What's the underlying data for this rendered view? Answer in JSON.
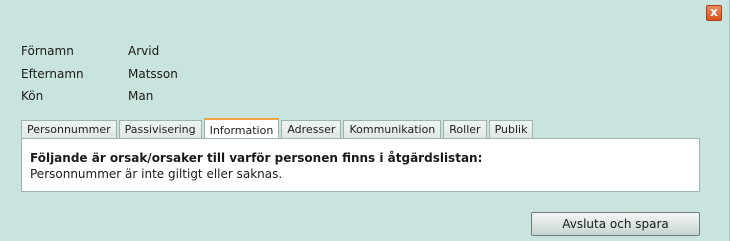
{
  "dialog": {
    "close_glyph": "x"
  },
  "person": {
    "fields": [
      {
        "label": "Förnamn",
        "value": "Arvid"
      },
      {
        "label": "Efternamn",
        "value": "Matsson"
      },
      {
        "label": "Kön",
        "value": "Man"
      }
    ]
  },
  "tabs": [
    {
      "label": "Personnummer",
      "active": false
    },
    {
      "label": "Passivisering",
      "active": false
    },
    {
      "label": "Information",
      "active": true
    },
    {
      "label": "Adresser",
      "active": false
    },
    {
      "label": "Kommunikation",
      "active": false
    },
    {
      "label": "Roller",
      "active": false
    },
    {
      "label": "Publik",
      "active": false
    }
  ],
  "panel": {
    "heading": "Följande är orsak/orsaker till varför personen finns i åtgärdslistan:",
    "text": "Personnummer är inte giltigt eller saknas."
  },
  "actions": {
    "save_label": "Avsluta och spara"
  },
  "colors": {
    "accent_tab": "#f0a23c",
    "close_button": "#e0622b",
    "background": "#c9e4de"
  }
}
